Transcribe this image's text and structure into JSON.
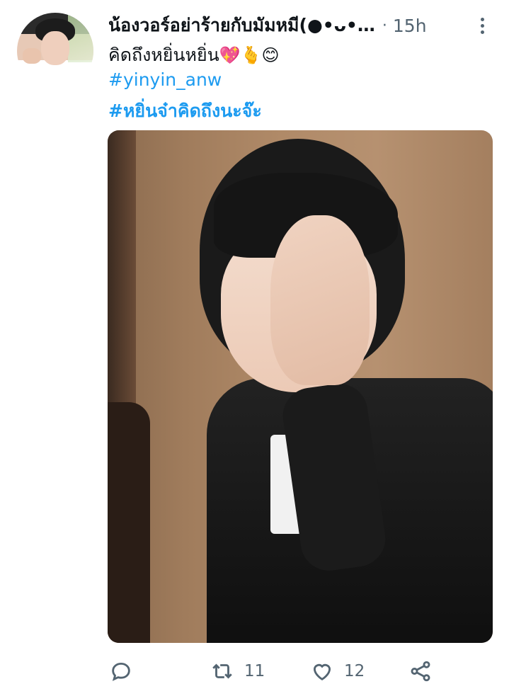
{
  "tweet": {
    "display_name": "น้องวอร์อย่าร้ายกับมัมหมี(●•ᴗ•…",
    "separator": "·",
    "time": "15h",
    "text_line1": "คิดถึงหยิ่นหยิ่น",
    "emoji_line1": "💖🫰😊",
    "hashtag1": "#yinyin_anw",
    "hashtag2": "#หยิ่นจ๋าคิดถึงนะจ๊ะ"
  },
  "actions": {
    "reply_count": "",
    "retweet_count": "11",
    "like_count": "12"
  },
  "icons": {
    "more": "more-vertical-icon",
    "reply": "reply-icon",
    "retweet": "retweet-icon",
    "like": "heart-icon",
    "share": "share-icon"
  },
  "colors": {
    "link": "#1d9bf0",
    "muted": "#536471",
    "text": "#0f1419"
  }
}
